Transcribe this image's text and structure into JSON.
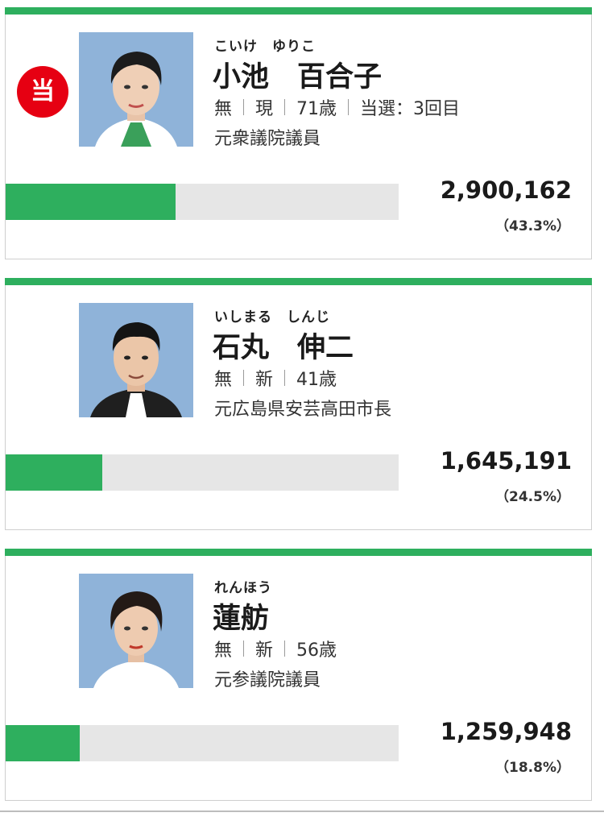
{
  "colors": {
    "accent_green": "#2eaf5e",
    "elected_red": "#e60012",
    "photo_bg": "#8fb3d9"
  },
  "candidates": [
    {
      "furigana": "こいけ　ゆりこ",
      "name": "小池　百合子",
      "elected_badge": "当",
      "party": "無",
      "status": "現",
      "age": "71歳",
      "terms": "当選：3回目",
      "career": "元衆議院議員",
      "votes": "2,900,162",
      "percent_label": "（43.3%）",
      "vote_share": 0.433,
      "photo_icon": "candidate-photo"
    },
    {
      "furigana": "いしまる　しんじ",
      "name": "石丸　伸二",
      "party": "無",
      "status": "新",
      "age": "41歳",
      "career": "元広島県安芸高田市長",
      "votes": "1,645,191",
      "percent_label": "（24.5%）",
      "vote_share": 0.245,
      "photo_icon": "candidate-photo"
    },
    {
      "furigana": "れんほう",
      "name": "蓮舫",
      "party": "無",
      "status": "新",
      "age": "56歳",
      "career": "元参議院議員",
      "votes": "1,259,948",
      "percent_label": "（18.8%）",
      "vote_share": 0.188,
      "photo_icon": "candidate-photo"
    }
  ]
}
